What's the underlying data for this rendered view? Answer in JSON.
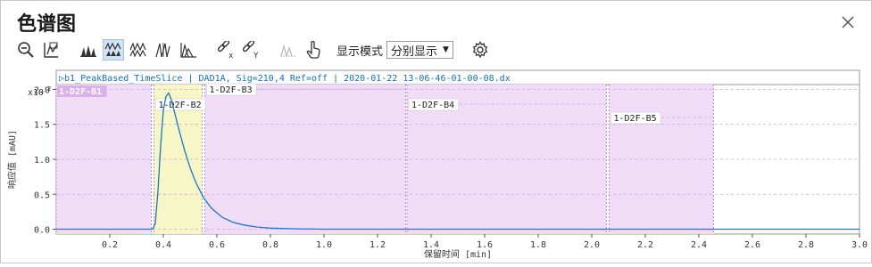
{
  "window": {
    "title": "色谱图"
  },
  "toolbar": {
    "icons": [
      "zoom-out-icon",
      "zoom-rect-icon",
      "peaks-overlay-icon",
      "peaks-separate-icon",
      "peaks-stacked-icon",
      "peaks-mirror-icon",
      "peaks-area-icon",
      "link-x-icon",
      "link-y-icon",
      "baseline-icon",
      "touch-icon"
    ],
    "display_mode_label": "显示模式",
    "display_mode_value": "分别显示",
    "settings_icon": "gear-icon"
  },
  "chart_data": {
    "type": "line",
    "header": "▷b1_PeakBased_TimeSlice | DAD1A, Sig=210,4 Ref=off | 2020-01-22 13-06-46-01-00-08.dx",
    "xlabel": "保留时间 [min]",
    "ylabel": "响应值 [mAU]",
    "y_multiplier": "x10",
    "y_multiplier_exp": "2",
    "xlim": [
      0.0,
      3.0
    ],
    "ylim": [
      -0.07,
      2.07
    ],
    "x_ticks": [
      "0.2",
      "0.4",
      "0.6",
      "0.8",
      "1.0",
      "1.2",
      "1.4",
      "1.6",
      "1.8",
      "2.0",
      "2.2",
      "2.4",
      "2.6",
      "2.8",
      "3.0"
    ],
    "y_ticks": [
      "0.0",
      "0.5",
      "1.0",
      "1.5",
      "2.0"
    ],
    "regions": [
      {
        "label": "1-D2F-B1",
        "start": 0.0,
        "end": 0.355,
        "color": "#f1dcf7"
      },
      {
        "label": "1-D2F-B2",
        "start": 0.365,
        "end": 0.545,
        "color": "#f6f6c6"
      },
      {
        "label": "1-D2F-B3",
        "start": 0.555,
        "end": 1.305,
        "color": "#f1dcf7"
      },
      {
        "label": "1-D2F-B4",
        "start": 1.31,
        "end": 2.055,
        "color": "#f1dcf7"
      },
      {
        "label": "1-D2F-B5",
        "start": 2.065,
        "end": 2.455,
        "color": "#f1dcf7"
      }
    ],
    "series": [
      {
        "x": [
          0.0,
          0.36,
          0.37,
          0.38,
          0.39,
          0.4,
          0.41,
          0.42,
          0.43,
          0.44,
          0.45,
          0.46,
          0.48,
          0.5,
          0.52,
          0.55,
          0.58,
          0.62,
          0.66,
          0.7,
          0.75,
          0.8,
          0.9,
          1.0,
          3.0
        ],
        "y": [
          0.0,
          0.0,
          0.08,
          0.55,
          1.2,
          1.7,
          1.9,
          1.95,
          1.85,
          1.7,
          1.55,
          1.4,
          1.12,
          0.88,
          0.68,
          0.45,
          0.3,
          0.17,
          0.1,
          0.06,
          0.03,
          0.015,
          0.005,
          0.0,
          0.0
        ],
        "color": "#1f77c4"
      }
    ]
  }
}
